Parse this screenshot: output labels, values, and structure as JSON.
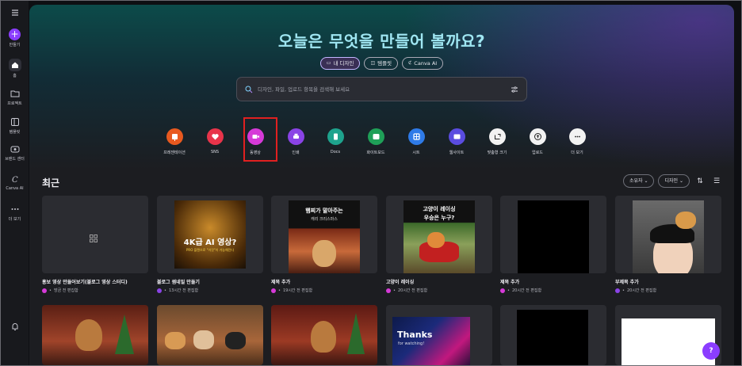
{
  "rail": {
    "create": "만들기",
    "home": "홈",
    "projects": "프로젝트",
    "templates": "템플릿",
    "brand": "브랜드 센터",
    "canva_ai": "Canva AI",
    "more": "더 보기"
  },
  "hero": {
    "title": "오늘은 무엇을 만들어 볼까요?",
    "pills": [
      {
        "label": "내 디자인",
        "icon": "folder-icon"
      },
      {
        "label": "템플릿",
        "icon": "template-icon"
      },
      {
        "label": "Canva AI",
        "icon": "canva-ai-icon"
      }
    ],
    "search_placeholder": "디자인, 파일, 업로드 항목을 검색해 보세요"
  },
  "shortcuts": [
    {
      "label": "프레젠테이션",
      "color": "#e8591f",
      "icon": "presentation-icon"
    },
    {
      "label": "SNS",
      "color": "#e8344a",
      "icon": "heart-icon"
    },
    {
      "label": "동영상",
      "color": "#d63ad8",
      "icon": "video-icon"
    },
    {
      "label": "인쇄",
      "color": "#8a43e6",
      "icon": "print-icon"
    },
    {
      "label": "Docs",
      "color": "#1ea38d",
      "icon": "docs-icon"
    },
    {
      "label": "화이트보드",
      "color": "#1fa058",
      "icon": "whiteboard-icon"
    },
    {
      "label": "시트",
      "color": "#2f7be8",
      "icon": "sheet-icon"
    },
    {
      "label": "웹사이트",
      "color": "#5a4ce0",
      "icon": "website-icon"
    },
    {
      "label": "맞춤형 크기",
      "color": "#f2f2f2",
      "icon": "custom-size-icon"
    },
    {
      "label": "업로드",
      "color": "#f2f2f2",
      "icon": "upload-icon"
    },
    {
      "label": "더 보기",
      "color": "#f2f2f2",
      "icon": "more-icon"
    }
  ],
  "recent": {
    "title": "최근",
    "owner_filter": "소유자",
    "type_filter": "디자인",
    "cards": [
      {
        "title": "홍보 영상 만들어보기(블로그 영상 스터디)",
        "meta": "방금 전 편집함",
        "dot": "#d63ad8"
      },
      {
        "title": "블로그 썸네일 만들기",
        "meta": "13시간 전 편집함",
        "dot": "#8a43e6",
        "thumb_text": "4K급 AI 영상?",
        "thumb_sub": "PRO 플랜으로 \"이것\"이 가능해진다"
      },
      {
        "title": "제목 추가",
        "meta": "19시간 전 편집함",
        "dot": "#d63ad8",
        "thumb_text": "햄찌가 말아주는",
        "thumb_sub": "캐리 크리스마스"
      },
      {
        "title": "고양이 레이싱",
        "meta": "20시간 전 편집함",
        "dot": "#d63ad8",
        "thumb_text": "고양이 레이싱",
        "thumb_sub": "우승은 누구?"
      },
      {
        "title": "제목 추가",
        "meta": "20시간 전 편집함",
        "dot": "#d63ad8"
      },
      {
        "title": "부제목 추가",
        "meta": "20시간 전 편집함",
        "dot": "#8a43e6"
      }
    ],
    "row2_texts": {
      "thanks": "Thanks",
      "thanks_sub": "for watching!"
    }
  },
  "help_label": "?"
}
